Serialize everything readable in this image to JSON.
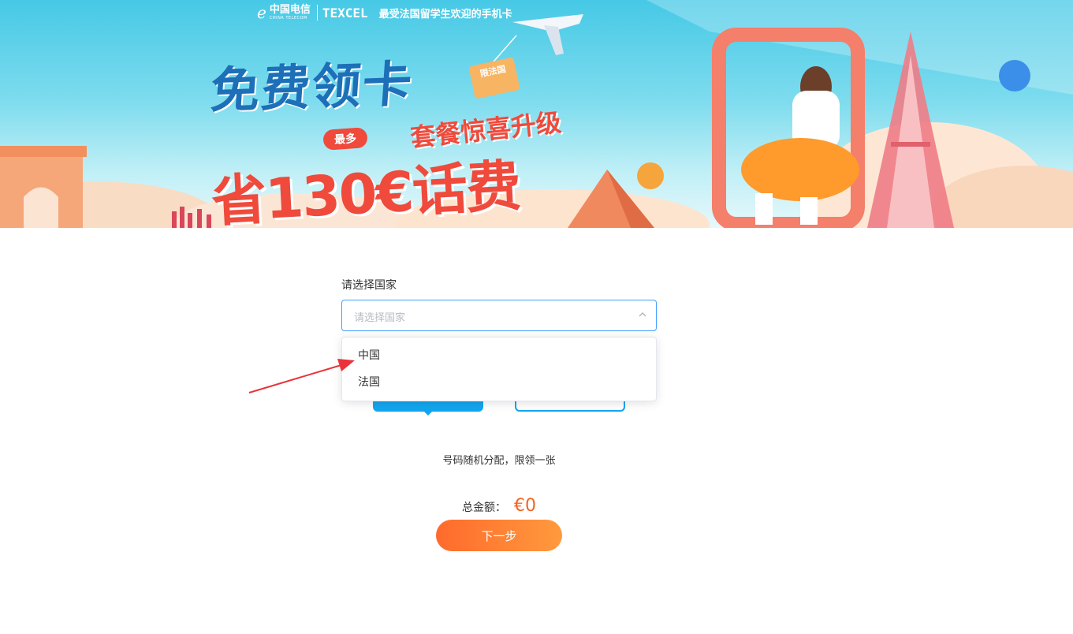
{
  "banner": {
    "logo_cn": "中国电信",
    "logo_en": "CHINA TELECOM",
    "logo_brand": "TEXCEL",
    "slogan": "最受法国留学生欢迎的手机卡",
    "headline_free": "免费领卡",
    "badge_most": "最多",
    "headline_upgrade": "套餐惊喜升级",
    "headline_save": "省130€话费",
    "tag_box": "限法国"
  },
  "form": {
    "country_label": "请选择国家",
    "country_placeholder": "请选择国家",
    "country_options": [
      "中国",
      "法国"
    ]
  },
  "info": {
    "note": "号码随机分配，限领一张",
    "total_label": "总金额：",
    "total_amount": "€0",
    "next_button": "下一步"
  },
  "colors": {
    "accent_blue": "#409eff",
    "tab_blue": "#12a6ee",
    "amount_orange": "#f26522",
    "button_gradient_start": "#ff6a2c",
    "button_gradient_end": "#ff9a3d",
    "annotation_red": "#e8343a"
  },
  "icons": {
    "select_arrow": "chevron-up-icon",
    "annotation": "red-arrow-icon"
  }
}
